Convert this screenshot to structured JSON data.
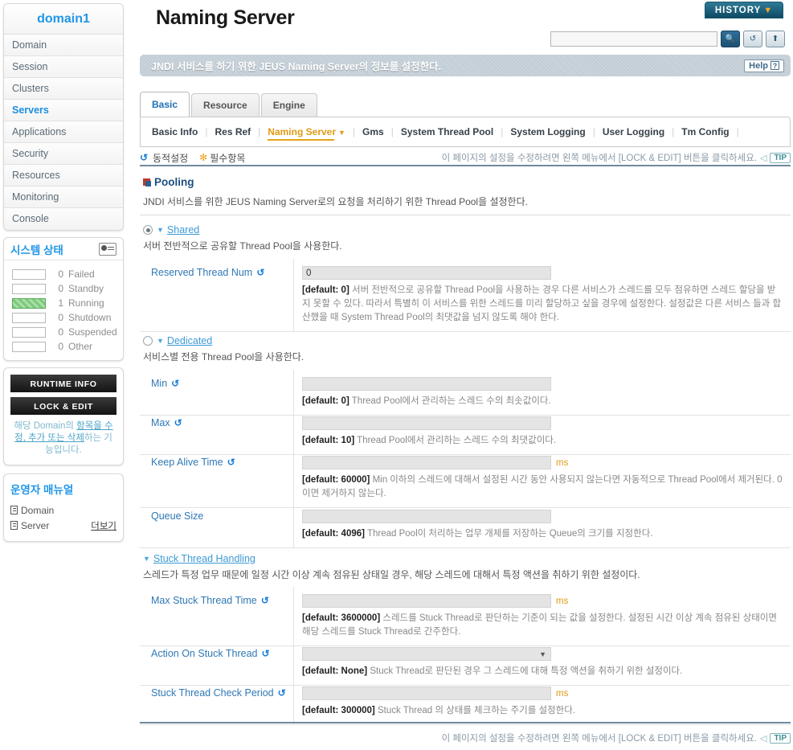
{
  "sidebar": {
    "domain_title": "domain1",
    "nav_items": [
      {
        "label": "Domain",
        "active": false
      },
      {
        "label": "Session",
        "active": false
      },
      {
        "label": "Clusters",
        "active": false
      },
      {
        "label": "Servers",
        "active": true
      },
      {
        "label": "Applications",
        "active": false
      },
      {
        "label": "Security",
        "active": false
      },
      {
        "label": "Resources",
        "active": false
      },
      {
        "label": "Monitoring",
        "active": false
      },
      {
        "label": "Console",
        "active": false
      }
    ],
    "system_status": {
      "title": "시스템 상태",
      "rows": [
        {
          "count": "0",
          "label": "Failed",
          "filled": false
        },
        {
          "count": "0",
          "label": "Standby",
          "filled": false
        },
        {
          "count": "1",
          "label": "Running",
          "filled": true
        },
        {
          "count": "0",
          "label": "Shutdown",
          "filled": false
        },
        {
          "count": "0",
          "label": "Suspended",
          "filled": false
        },
        {
          "count": "0",
          "label": "Other",
          "filled": false
        }
      ]
    },
    "runtime_info_label": "RUNTIME INFO",
    "lock_edit_label": "LOCK & EDIT",
    "lock_note_1": "해당 Domain의 ",
    "lock_note_link": "항목을 수정, 추가 또는 삭제",
    "lock_note_2": "하는 기능입니다.",
    "manual": {
      "title": "운영자 매뉴얼",
      "items": [
        "Domain",
        "Server"
      ],
      "more_label": "더보기"
    }
  },
  "header": {
    "app_title": "Naming Server",
    "history_label": "HISTORY",
    "history_caret": "▼",
    "search_placeholder": "",
    "search_value": "",
    "icons": [
      "search-icon",
      "refresh-icon",
      "xml-export-icon"
    ]
  },
  "banner": {
    "text": "JNDI 서비스를 하기 위한 JEUS Naming Server의 정보를 설정한다.",
    "help_label": "Help",
    "help_glyph": "?"
  },
  "tabs": [
    {
      "label": "Basic",
      "active": true
    },
    {
      "label": "Resource",
      "active": false
    },
    {
      "label": "Engine",
      "active": false
    }
  ],
  "subnav": [
    {
      "label": "Basic Info",
      "active": false
    },
    {
      "label": "Res Ref",
      "active": false
    },
    {
      "label": "Naming Server",
      "active": true
    },
    {
      "label": "Gms",
      "active": false
    },
    {
      "label": "System Thread Pool",
      "active": false
    },
    {
      "label": "System Logging",
      "active": false
    },
    {
      "label": "User Logging",
      "active": false
    },
    {
      "label": "Tm Config",
      "active": false
    }
  ],
  "legend": {
    "dynamic_label": "동적설정",
    "required_label": "필수항목",
    "dynamic_glyph": "↺",
    "required_glyph": "✻",
    "tip_text": "이 페이지의 설정을 수정하려면 왼쪽 메뉴에서 [LOCK & EDIT] 버튼을 클릭하세요.",
    "tip_badge": "TIP",
    "tip_arrow": "◁"
  },
  "section": {
    "title": "Pooling",
    "description": "JNDI 서비스를 위한 JEUS Naming Server로의 요청을 처리하기 위한 Thread Pool을 설정한다."
  },
  "groups": {
    "shared": {
      "label": "Shared",
      "description": "서버 전반적으로 공유할 Thread Pool을 사용한다.",
      "selected": true,
      "caret": "▼"
    },
    "dedicated": {
      "label": "Dedicated",
      "description": "서비스별 전용 Thread Pool을 사용한다.",
      "selected": false,
      "caret": "▼"
    },
    "stuck": {
      "label": "Stuck Thread Handling",
      "description": "스레드가 특정 업무 때문에 일정 시간 이상 계속 점유된 상태일 경우, 해당 스레드에 대해서 특정 액션을 취하기 위한 설정이다.",
      "caret": "▼"
    }
  },
  "fields": {
    "reserved_thread_num": {
      "label": "Reserved Thread Num",
      "dynamic": true,
      "value": "0",
      "unit": "",
      "default_text": "[default: 0]",
      "hint": "서버 전반적으로 공유할 Thread Pool을 사용하는 경우 다른 서비스가 스레드를 모두 점유하면 스레드 할당을 받지 못할 수 있다. 따라서 특별히 이 서비스를 위한 스레드를 미리 할당하고 싶을 경우에 설정한다. 설정값은 다른 서비스 들과 합산했을 때 System Thread Pool의 최댓값을 넘지 않도록 해야 한다."
    },
    "min": {
      "label": "Min",
      "dynamic": true,
      "value": "",
      "unit": "",
      "default_text": "[default: 0]",
      "hint": "Thread Pool에서 관리하는 스레드 수의 최솟값이다."
    },
    "max": {
      "label": "Max",
      "dynamic": true,
      "value": "",
      "unit": "",
      "default_text": "[default: 10]",
      "hint": "Thread Pool에서 관리하는 스레드 수의 최댓값이다."
    },
    "keep_alive_time": {
      "label": "Keep Alive Time",
      "dynamic": true,
      "value": "",
      "unit": "ms",
      "default_text": "[default: 60000]",
      "hint": "Min 이하의 스레드에 대해서 설정된 시간 동안 사용되지 않는다면 자동적으로 Thread Pool에서 제거된다. 0이면 제거하지 않는다."
    },
    "queue_size": {
      "label": "Queue Size",
      "dynamic": false,
      "value": "",
      "unit": "",
      "default_text": "[default: 4096]",
      "hint": "Thread Pool이 처리하는 업무 개체를 저장하는 Queue의 크기를 지정한다."
    },
    "max_stuck_thread_time": {
      "label": "Max Stuck Thread Time",
      "dynamic": true,
      "value": "",
      "unit": "ms",
      "default_text": "[default: 3600000]",
      "hint": "스레드를 Stuck Thread로 판단하는 기준이 되는 값을 설정한다. 설정된 시간 이상 계속 점유된 상태이면 해당 스레드를 Stuck Thread로 간주한다."
    },
    "action_on_stuck_thread": {
      "label": "Action On Stuck Thread",
      "dynamic": true,
      "value": "",
      "unit": "",
      "is_select": true,
      "select_caret": "▼",
      "default_text": "[default: None]",
      "hint": "Stuck Thread로 판단된 경우 그 스레드에 대해 특정 액션을 취하기 위한 설정이다."
    },
    "stuck_thread_check_period": {
      "label": "Stuck Thread Check Period",
      "dynamic": true,
      "value": "",
      "unit": "ms",
      "default_text": "[default: 300000]",
      "hint": "Stuck Thread 의 상태를 체크하는 주기를 설정한다."
    }
  },
  "footer": {
    "tip_text": "이 페이지의 설정을 수정하려면 왼쪽 메뉴에서 [LOCK & EDIT] 버튼을 클릭하세요.",
    "tip_badge": "TIP",
    "tip_arrow": "◁"
  },
  "colors": {
    "accent_blue": "#2196e8",
    "link_blue": "#3d9ad6",
    "label_blue": "#2f78b5",
    "orange": "#e09a14",
    "banner_gray": "#9fb0bd",
    "running_green": "#7ec97e"
  }
}
